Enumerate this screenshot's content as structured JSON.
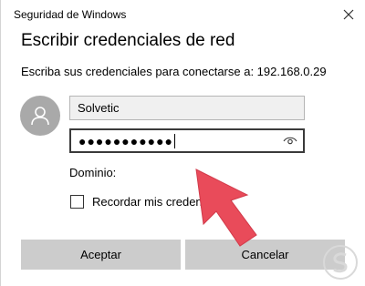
{
  "window": {
    "title": "Seguridad de Windows",
    "close_icon": "close-icon"
  },
  "dialog": {
    "heading": "Escribir credenciales de red",
    "instruction": "Escriba sus credenciales para conectarse a: 192.168.0.29"
  },
  "form": {
    "username_value": "Solvetic",
    "password_masked": "●●●●●●●●●●●",
    "reveal_icon": "eye-icon",
    "domain_label": "Dominio:",
    "remember_label": "Recordar mis credenciales",
    "remember_checked": false
  },
  "buttons": {
    "ok": "Aceptar",
    "cancel": "Cancelar"
  },
  "colors": {
    "button_bg": "#cccccc",
    "avatar_bg": "#a9a9a9",
    "arrow": "#e94b5a"
  }
}
